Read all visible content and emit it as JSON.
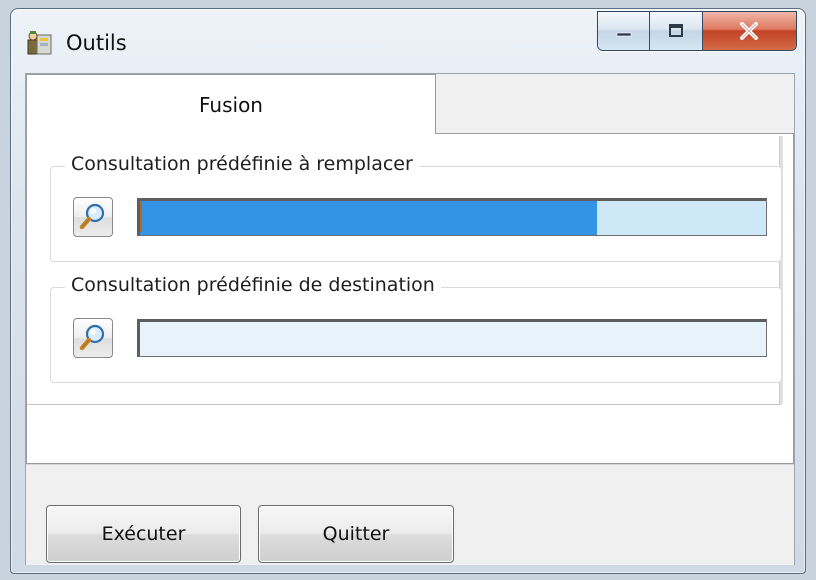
{
  "window": {
    "title": "Outils",
    "icon": "tools-app-icon",
    "controls": {
      "minimize_icon": "minimize-icon",
      "maximize_icon": "maximize-icon",
      "close_icon": "close-icon"
    }
  },
  "tabs": [
    {
      "label": "Fusion",
      "active": true
    }
  ],
  "groups": [
    {
      "label": "Consultation prédéfinie à remplacer",
      "search_icon": "magnifier-icon",
      "field_value": "",
      "selection_fill_percent": 73
    },
    {
      "label": "Consultation prédéfinie de destination",
      "search_icon": "magnifier-icon",
      "field_value": ""
    }
  ],
  "buttons": {
    "execute_label": "Exécuter",
    "quit_label": "Quitter"
  },
  "colors": {
    "selection_blue": "#3394e6",
    "field_bg": "#e8f2fb",
    "close_red": "#c24225"
  }
}
